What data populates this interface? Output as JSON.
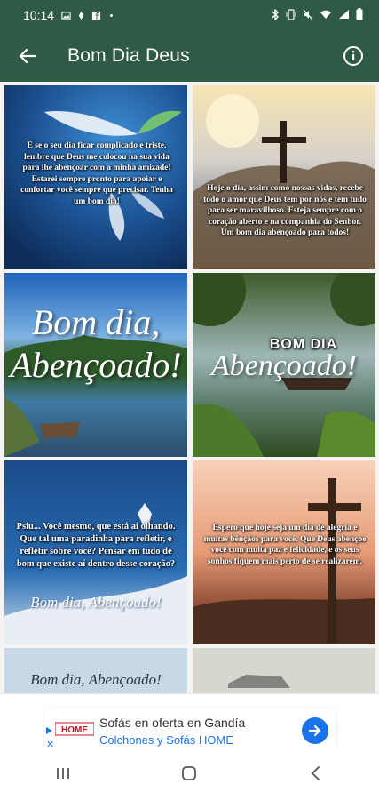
{
  "status_bar": {
    "time": "10:14",
    "icons_left": [
      "gallery-icon",
      "notification-icon",
      "fb-icon",
      "dot-icon"
    ],
    "icons_right": [
      "bluetooth-icon",
      "vibrate-icon",
      "mute-icon",
      "wifi-icon",
      "signal-icon",
      "battery-icon"
    ]
  },
  "app_bar": {
    "title": "Bom Dia Deus",
    "back_icon": "arrow-left-icon",
    "info_icon": "info-icon",
    "color": "#2f5b46"
  },
  "tiles": [
    {
      "caption": "E se o seu dia ficar complicado e triste, lembre que Deus me colocou na sua vida para lhe abençoar com a minha amizade! Estarei sempre pronto para apoiar e confortar você sempre que precisar. Tenha um bom dia!"
    },
    {
      "caption": "Hoje o dia, assim como nossas vidas, recebe todo o amor que Deus tem por nós e tem tudo para ser maravilhoso. Esteja sempre com o coração aberto e na companhia do Senhor. Um bom dia abençoado para todos!"
    },
    {
      "line1": "Bom dia,",
      "line2": "Abençoado!"
    },
    {
      "line1": "BOM DIA",
      "line2": "Abençoado!"
    },
    {
      "caption": "Psiu... Você mesmo, que está aí olhando. Que tal uma paradinha para refletir, e refletir sobre você? Pensar em tudo de bom que existe aí dentro desse coração?",
      "signature": "Bom dia, Abençoado!"
    },
    {
      "caption": "Espero que hoje seja um dia de alegria e muitas bênçãos para você. Que Deus abençoe você com muita paz e felicidade, e os seus sonhos fiquem mais perto de se realizarem."
    },
    {
      "signature": "Bom dia, Abençoado!"
    },
    {}
  ],
  "ad": {
    "brand": "HOME",
    "title": "Sofás en oferta en Gandía",
    "subtitle": "Colchones y Sofás HOME",
    "accent": "#1a73e8"
  },
  "nav": {
    "recents_icon": "recents-icon",
    "home_icon": "home-icon",
    "back_icon": "back-chevron-icon"
  }
}
